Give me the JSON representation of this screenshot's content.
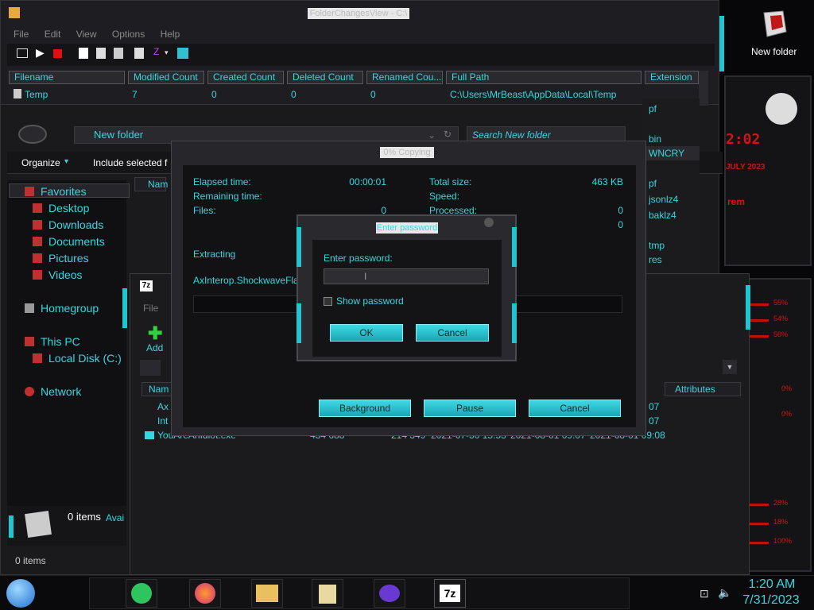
{
  "fov": {
    "title": "FolderChangesView - C:\\",
    "menu": [
      "File",
      "Edit",
      "View",
      "Options",
      "Help"
    ],
    "columns": [
      "Filename",
      "Modified Count",
      "Created Count",
      "Deleted Count",
      "Renamed Cou...",
      "Full Path",
      "Extension"
    ],
    "row": {
      "filename": "Temp",
      "modified": "7",
      "created": "0",
      "deleted": "0",
      "renamed": "0",
      "path": "C:\\Users\\MrBeast\\AppData\\Local\\Temp"
    },
    "extensions": [
      "pf",
      "bin",
      "WNCRY",
      "pf",
      "jsonlz4",
      "baklz4",
      "tmp",
      "res"
    ]
  },
  "explorer": {
    "address": "New folder",
    "search_placeholder": "Search New folder",
    "organize": "Organize",
    "include": "Include selected f",
    "name_col": "Nam",
    "status": "0 items",
    "details_count": "0 items",
    "details_avail": "Avai",
    "nav": {
      "favorites": "Favorites",
      "desktop": "Desktop",
      "downloads": "Downloads",
      "documents": "Documents",
      "pictures": "Pictures",
      "videos": "Videos",
      "homegroup": "Homegroup",
      "thispc": "This PC",
      "localdisk": "Local Disk (C:)",
      "network": "Network"
    }
  },
  "sevenz": {
    "logo": "7z",
    "menu_file": "File",
    "add": "Add",
    "name_col": "Nam",
    "attributes_col": "Attributes",
    "rows": [
      {
        "name": "Ax",
        "tail": "07"
      },
      {
        "name": "Int",
        "tail": "07"
      },
      {
        "name": "YouAreAnIdiot.exe",
        "size": "434 688",
        "packed": "214 349",
        "modified": "2021-07-30 15:53",
        "created": "2021-08-01 09:07",
        "accessed": "2021-08-01 09:08"
      }
    ]
  },
  "copy": {
    "title": "0% Copying",
    "elapsed_label": "Elapsed time:",
    "elapsed_val": "00:00:01",
    "remaining_label": "Remaining time:",
    "files_label": "Files:",
    "files_val": "0",
    "total_label": "Total size:",
    "total_val": "463 KB",
    "speed_label": "Speed:",
    "processed_label": "Processed:",
    "processed_val": "0",
    "extra_val": "0",
    "extracting": "Extracting",
    "file": "AxInterop.ShockwaveFlashO",
    "btn_background": "Background",
    "btn_pause": "Pause",
    "btn_cancel": "Cancel"
  },
  "pwd": {
    "title": "Enter password",
    "label": "Enter password:",
    "show": "Show password",
    "ok": "OK",
    "cancel": "Cancel"
  },
  "desktop": {
    "newfolder": "New folder",
    "clock_fragment": "2:02",
    "date_fragment": "JULY 2023",
    "gadget_text": "rem",
    "percents": [
      "55%",
      "54%",
      "56%",
      "0%",
      "0%",
      "28%",
      "18%",
      "100%"
    ]
  },
  "taskbar": {
    "time": "1:20 AM",
    "date": "7/31/2023",
    "sevenz_label": "7z"
  },
  "colors": {
    "accent": "#36d6e0",
    "alert": "#d01414"
  }
}
